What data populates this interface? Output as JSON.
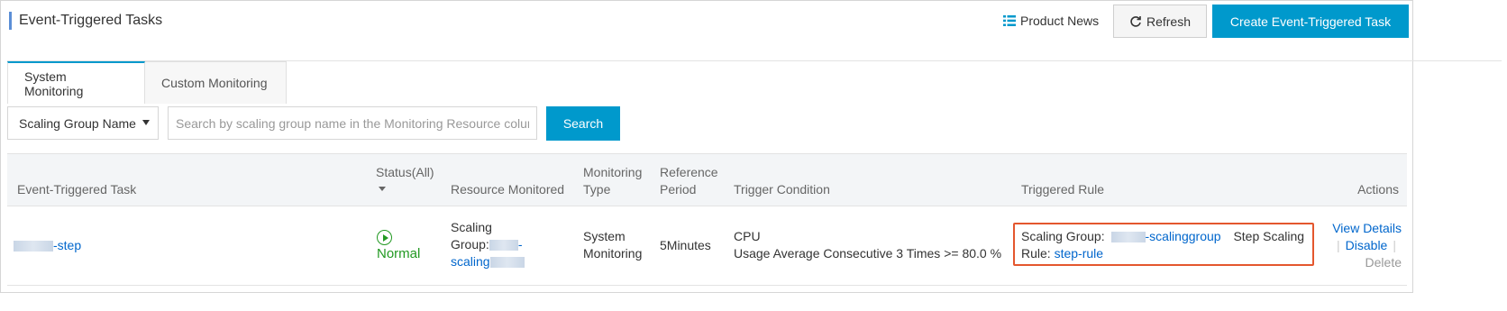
{
  "header": {
    "title": "Event-Triggered Tasks",
    "product_news": "Product News",
    "refresh": "Refresh",
    "create": "Create Event-Triggered Task"
  },
  "tabs": [
    {
      "label": "System Monitoring",
      "active": true
    },
    {
      "label": "Custom Monitoring",
      "active": false
    }
  ],
  "search": {
    "select_value": "Scaling Group Name",
    "placeholder": "Search by scaling group name in the Monitoring Resource colun",
    "button": "Search"
  },
  "table": {
    "columns": {
      "task": "Event-Triggered Task",
      "status_line1": "Status(All)",
      "resource": "Resource Monitored",
      "mon_type_1": "Monitoring",
      "mon_type_2": "Type",
      "ref_1": "Reference",
      "ref_2": "Period",
      "trigger": "Trigger Condition",
      "rule": "Triggered Rule",
      "actions": "Actions"
    },
    "rows": [
      {
        "task_suffix": "-step",
        "status": "Normal",
        "resource_line1": "Scaling",
        "resource_line2": "Group:",
        "resource_link_suffix": "-",
        "resource_link_line2": "scaling",
        "mon_type_1": "System",
        "mon_type_2": "Monitoring",
        "ref_period": "5Minutes",
        "trigger_1": "CPU",
        "trigger_2": "Usage Average Consecutive 3 Times >= 80.0 %",
        "rule_group_label": "Scaling Group:",
        "rule_group_link": "-scalinggroup",
        "rule_type": "Step Scaling",
        "rule_label": "Rule:",
        "rule_link": "step-rule",
        "action_view": "View Details",
        "action_disable": "Disable",
        "action_delete": "Delete"
      }
    ]
  },
  "colors": {
    "accent": "#0099cc",
    "link": "#0066cc",
    "status_normal": "#229922",
    "highlight_box": "#e4572e"
  }
}
